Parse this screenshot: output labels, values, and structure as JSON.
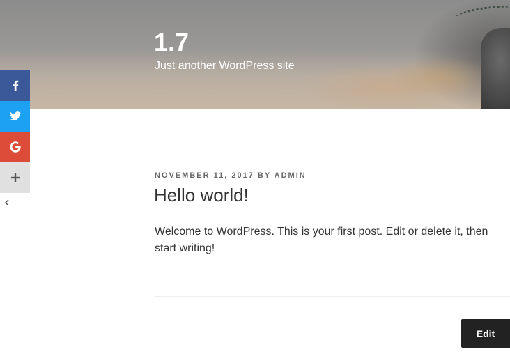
{
  "site": {
    "title": "1.7",
    "description": "Just another WordPress site"
  },
  "social": {
    "facebook_icon": "facebook-icon",
    "twitter_icon": "twitter-icon",
    "google_icon": "google-icon",
    "more_icon": "plus-icon",
    "collapse_icon": "chevron-left-icon",
    "colors": {
      "facebook": "#3b5998",
      "twitter": "#1da1f2",
      "google": "#dd4b39",
      "more": "#e0e0e0"
    }
  },
  "post": {
    "date": "November 11, 2017",
    "by": "by",
    "author": "admin",
    "title": "Hello world!",
    "body": "Welcome to WordPress. This is your first post. Edit or delete it, then start writing!"
  },
  "actions": {
    "edit_label": "Edit"
  }
}
